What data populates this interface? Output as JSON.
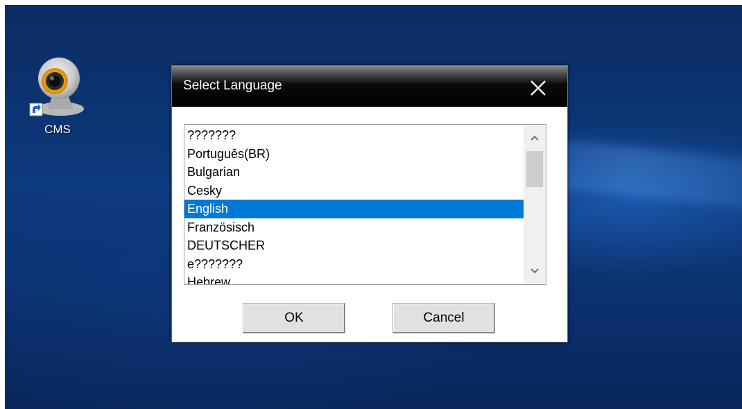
{
  "desktop": {
    "icon_label": "CMS",
    "icon": "webcam-icon"
  },
  "dialog": {
    "title": "Select Language",
    "close_icon": "close-icon",
    "languages": [
      "???????",
      "Português(BR)",
      "Bulgarian",
      "Cesky",
      "English",
      "Französisch",
      "DEUTSCHER",
      "e???????",
      "Hebrew"
    ],
    "selected_index": 4,
    "ok_label": "OK",
    "cancel_label": "Cancel"
  },
  "colors": {
    "selection": "#0078d7",
    "desktop_background": "#0d3a7d",
    "titlebar": "#000000"
  }
}
